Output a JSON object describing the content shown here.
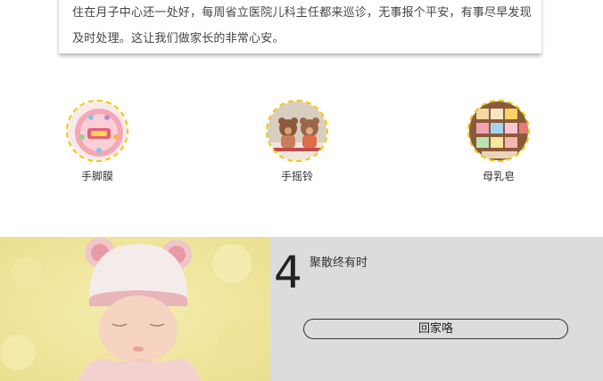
{
  "intro": {
    "text": "住在月子中心还一处好，每周省立医院儿科主任都来巡诊，无事报个平安，有事尽早发现及时处理。这让我们做家长的非常心安。"
  },
  "products": [
    {
      "label": "手脚膜",
      "icon": "foot-mask-product-photo"
    },
    {
      "label": "手摇铃",
      "icon": "rattle-toy-photo"
    },
    {
      "label": "母乳皂",
      "icon": "breastmilk-soap-photo"
    }
  ],
  "story": {
    "number": "4",
    "caption": "聚散终有时",
    "button_label": "回家咯"
  },
  "colors": {
    "dashed_ring": "#f5c400",
    "panel_bg": "#dcdcdc"
  }
}
